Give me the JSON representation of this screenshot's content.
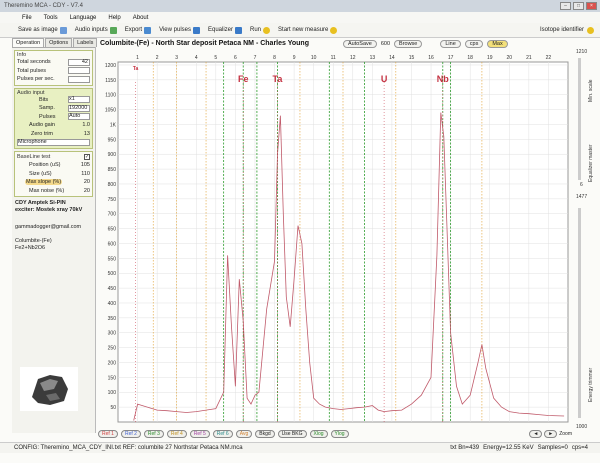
{
  "window": {
    "title": "Theremino MCA - CDY - V7.4"
  },
  "menu": [
    "File",
    "Tools",
    "Language",
    "Help",
    "About"
  ],
  "toolbar": {
    "save_image": "Save as image",
    "audio_inputs": "Audio inputs",
    "export": "Export",
    "view_pulses": "View pulses",
    "equalizer": "Equalizer",
    "run": "Run",
    "start_new_measure": "Start new measure",
    "isotope_identifier": "Isotope identifier"
  },
  "tabs": [
    "Operation",
    "Options",
    "Labels"
  ],
  "info": {
    "title": "Info",
    "total_seconds_label": "Total seconds",
    "total_seconds": "42",
    "total_pulses_label": "Total pulses",
    "total_pulses": "",
    "pulses_per_sec_label": "Pulses per sec.",
    "pulses_per_sec": ""
  },
  "audio": {
    "title": "Audio input",
    "bits_label": "Bits",
    "bits": "x1",
    "samp_label": "Samp.",
    "samp": "192000",
    "pulses_label": "Pulses",
    "pulses": "Auto",
    "gain_label": "Audio gain",
    "gain": "1.0",
    "zero_label": "Zero trim",
    "zero": "13",
    "device": "Microphone"
  },
  "baseline": {
    "title": "BaseLine test",
    "position_label": "Position (uS)",
    "position": "105",
    "size_label": "Size (uS)",
    "size": "110",
    "max_slope_label": "Max slope (%)",
    "max_slope": "20",
    "max_noise_label": "Max noise (%)",
    "max_noise": "20"
  },
  "notes": {
    "detector": "CDY Amptek Si-PIN",
    "exciter": "exciter: Mostek xray 70kV",
    "email": "gammadogger@gmail.com",
    "sample": "Columbite-(Fe)",
    "formula": "Fe2+Nb2O6"
  },
  "plot_header": {
    "title": "Columbite-(Fe) - North Star deposit Petaca NM - Charles Young",
    "autosave": "AutoSave",
    "number": "600",
    "browse": "Browse",
    "line": "Line",
    "cps": "cps",
    "max": "Max"
  },
  "right_panel": {
    "top_value": "1210",
    "mid_value": "1477",
    "bottom_value": "1000",
    "six": "6",
    "min_scale": "Min. scale",
    "eq_master": "Equalizer master",
    "energy_trimmer": "Energy trimmer",
    "zoom": "Zoom"
  },
  "bottom_buttons": [
    "Ref 1",
    "Ref 2",
    "Ref 3",
    "Ref 4",
    "Ref 5",
    "Ref 6",
    "Avg",
    "Bkgd",
    "Use BKG",
    "Xlog",
    "Ylog"
  ],
  "status": {
    "config": "CONFIG: Theremino_MCA_CDY_INI.txt  REF: columbite 27  Northstar Petaca NM.mca",
    "bin": "txt Bn=439",
    "energy": "Energy=12.55 KeV",
    "samples": "Samples=0",
    "cps": "cps=4"
  },
  "colors": {
    "spectrum": "#c05a6a",
    "grid": "#e0e0e0",
    "green_line": "#2a9a2a",
    "orange_line": "#e0a030",
    "element_label": "#c43040"
  },
  "chart_data": {
    "type": "line",
    "xlabel": "",
    "ylabel": "",
    "xlim": [
      0,
      23
    ],
    "ylim": [
      0,
      1210
    ],
    "x_ticks": [
      1,
      2,
      3,
      4,
      5,
      6,
      7,
      8,
      9,
      10,
      11,
      12,
      13,
      14,
      15,
      16,
      17,
      18,
      19,
      20,
      21,
      22
    ],
    "y_ticks": [
      50,
      100,
      150,
      200,
      250,
      300,
      350,
      400,
      450,
      500,
      550,
      600,
      650,
      700,
      750,
      800,
      850,
      900,
      950,
      1000,
      1050,
      1100,
      1150,
      1200
    ],
    "y_tick_labels": [
      "50",
      "100",
      "150",
      "200",
      "250",
      "300",
      "350",
      "400",
      "450",
      "500",
      "550",
      "600",
      "650",
      "700",
      "750",
      "800",
      "850",
      "900",
      "950",
      "1K",
      "1050",
      "1100",
      "1150",
      "1200"
    ],
    "series": [
      {
        "x": [
          0.8,
          1.0,
          1.5,
          2.0,
          2.5,
          3.0,
          3.5,
          4.0,
          4.5,
          5.0,
          5.4,
          5.6,
          5.8,
          6.0,
          6.2,
          6.4,
          6.6,
          6.8,
          7.0,
          7.2,
          7.6,
          8.0,
          8.15,
          8.3,
          8.45,
          8.6,
          8.8,
          9.0,
          9.2,
          9.4,
          9.6,
          9.8,
          10.0,
          10.3,
          10.6,
          11.0,
          11.4,
          11.8,
          12.2,
          12.6,
          13.0,
          13.3,
          13.6,
          14.0,
          14.5,
          15.0,
          15.5,
          16.0,
          16.3,
          16.5,
          16.65,
          16.8,
          17.0,
          17.3,
          17.6,
          18.0,
          18.4,
          18.6,
          18.8,
          19.2,
          19.6,
          20.0,
          20.5,
          21.0,
          21.5,
          22.0,
          22.8
        ],
        "y": [
          5,
          60,
          50,
          40,
          38,
          35,
          32,
          35,
          40,
          45,
          100,
          560,
          320,
          120,
          480,
          340,
          80,
          60,
          90,
          100,
          380,
          540,
          900,
          1030,
          700,
          420,
          320,
          480,
          660,
          600,
          380,
          200,
          80,
          60,
          50,
          45,
          42,
          45,
          48,
          50,
          55,
          40,
          35,
          38,
          40,
          60,
          90,
          150,
          560,
          1040,
          960,
          680,
          300,
          120,
          60,
          90,
          200,
          260,
          180,
          80,
          50,
          35,
          30,
          28,
          25,
          22,
          20
        ]
      }
    ],
    "element_markers": [
      {
        "label": "Ta",
        "x": 0.9,
        "color": "#c43040",
        "big": false
      },
      {
        "label": "Fe",
        "x": 6.4,
        "color": "#c43040",
        "big": true
      },
      {
        "label": "Ta",
        "x": 8.15,
        "color": "#c43040",
        "big": true
      },
      {
        "label": "U",
        "x": 13.6,
        "color": "#c43040",
        "big": true
      },
      {
        "label": "Nb",
        "x": 16.6,
        "color": "#c43040",
        "big": true
      }
    ],
    "green_lines": [
      5.4,
      6.4,
      7.1,
      8.15,
      10.8,
      12.6,
      16.6,
      17.0
    ],
    "orange_lines": [
      1.8,
      3.0,
      4.5,
      9.3,
      11.5,
      14.2,
      18.6
    ],
    "grid": true
  }
}
